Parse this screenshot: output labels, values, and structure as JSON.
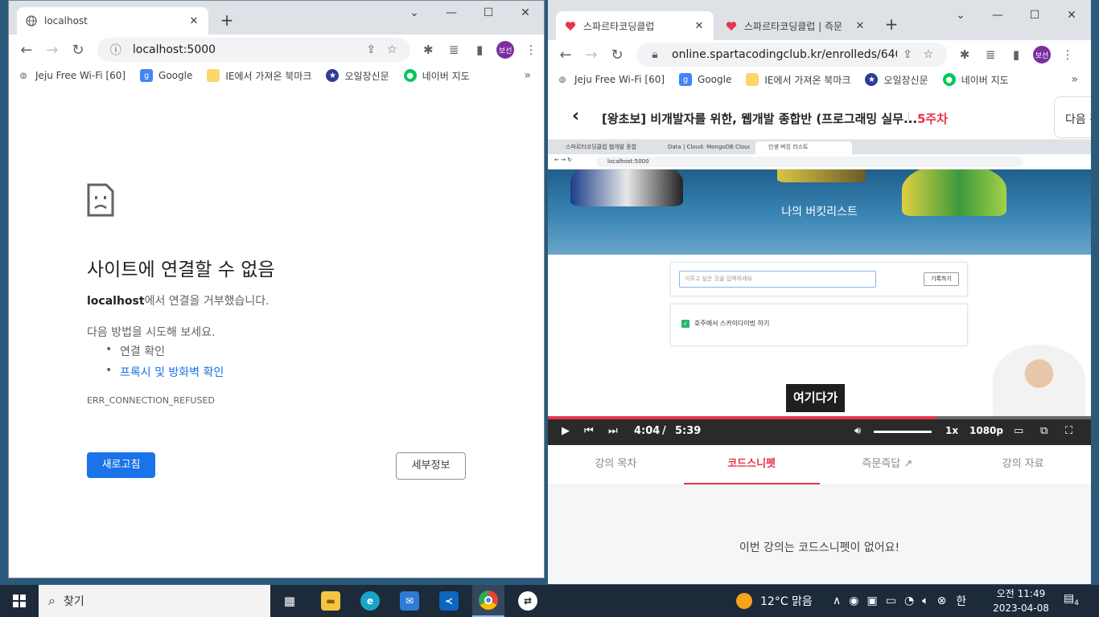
{
  "left_window": {
    "tab_title": "localhost",
    "address": "localhost:5000",
    "bookmarks": [
      "Jeju Free Wi-Fi [60]",
      "Google",
      "IE에서 가져온 북마크",
      "오일장신문",
      "네이버 지도"
    ],
    "error": {
      "title": "사이트에 연결할 수 없음",
      "host": "localhost",
      "message": "에서 연결을 거부했습니다.",
      "try_heading": "다음 방법을 시도해 보세요.",
      "suggestions": [
        "연결 확인",
        "프록시 및 방화벽 확인"
      ],
      "code": "ERR_CONNECTION_REFUSED",
      "reload_label": "새로고침",
      "details_label": "세부정보"
    },
    "profile": "보선"
  },
  "right_window": {
    "tabs": [
      "스파르타코딩클럽",
      "스파르타코딩클럽 | 즉문"
    ],
    "address": "online.spartacodingclub.kr/enrolleds/640a83...",
    "bookmarks": [
      "Jeju Free Wi-Fi [60]",
      "Google",
      "IE에서 가져온 북마크",
      "오일장신문",
      "네이버 지도"
    ],
    "profile": "보선",
    "course_title": "[왕초보] 비개발자를 위한, 웹개발 종합반 (프로그래밍 실무...",
    "week": "5주차",
    "next_label": "다음 강",
    "video": {
      "inner_tabs": [
        "스파르타코딩클럽 웹개발 종합",
        "Data | Cloud: MongoDB Cloud",
        "인생 버킷 리스트"
      ],
      "inner_address": "localhost:5000",
      "hero_title": "나의 버킷리스트",
      "input_placeholder": "이루고 싶은 것을 입력하세요",
      "record_btn": "기록하기",
      "item": "호주에서 스카이다이빙 하기",
      "caption": "여기다가",
      "current_time": "4:04",
      "time_sep": "/",
      "duration": "5:39",
      "progress": 0.715,
      "volume": 1.0,
      "speed": "1x",
      "quality": "1080p"
    },
    "course_tabs": [
      "강의 목차",
      "코드스니펫",
      "즉문즉답",
      "강의 자료"
    ],
    "active_tab": 1,
    "snippet_msg": "이번 강의는 코드스니펫이 없어요!"
  },
  "taskbar": {
    "search_placeholder": "찾기",
    "weather": "12°C  맑음",
    "ime": "한",
    "time": "오전 11:49",
    "date": "2023-04-08",
    "notifications": "4"
  },
  "colors": {
    "chrome_tabbar": "#dee1e6",
    "google_blue": "#1a73e8",
    "sparta_red": "#e8344e",
    "taskbar": "#1c2a3a"
  }
}
